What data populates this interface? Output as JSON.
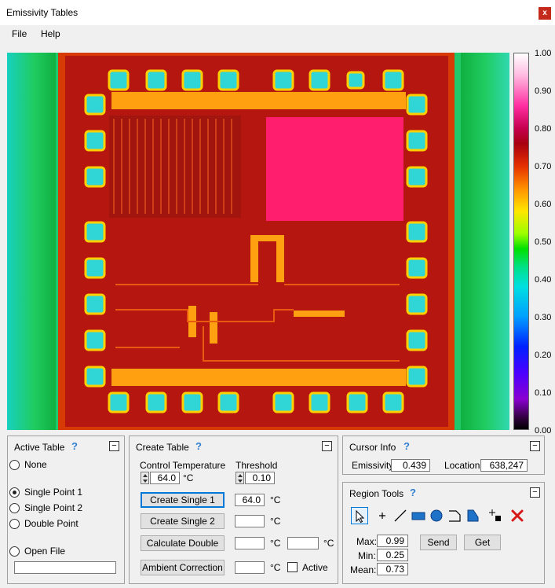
{
  "window": {
    "title": "Emissivity Tables",
    "close_glyph": "x"
  },
  "menu": {
    "items": [
      "File",
      "Help"
    ]
  },
  "colorbar": {
    "ticks": [
      "1.00",
      "0.90",
      "0.80",
      "0.70",
      "0.60",
      "0.50",
      "0.40",
      "0.30",
      "0.20",
      "0.10",
      "0.00"
    ]
  },
  "active_table": {
    "title": "Active Table",
    "help": "?",
    "collapse": "−",
    "options": [
      "None",
      "Single Point 1",
      "Single Point 2",
      "Double Point",
      "Open File"
    ],
    "selected": "Single Point 1",
    "file_path": ""
  },
  "create_table": {
    "title": "Create Table",
    "help": "?",
    "collapse": "−",
    "control_temp_label": "Control Temperature",
    "control_temp_value": "64.0",
    "threshold_label": "Threshold",
    "threshold_value": "0.10",
    "unit": "°C",
    "buttons": {
      "single1": "Create Single 1",
      "single2": "Create Single 2",
      "double": "Calculate Double",
      "ambient": "Ambient Correction"
    },
    "single1_value": "64.0",
    "single2_value": "",
    "double_value_a": "",
    "double_value_b": "",
    "ambient_value": "",
    "active_label": "Active",
    "active_checked": false
  },
  "cursor_info": {
    "title": "Cursor Info",
    "help": "?",
    "collapse": "−",
    "emissivity_label": "Emissivity",
    "emissivity_value": "0.439",
    "location_label": "Location",
    "location_value": "638,247"
  },
  "region_tools": {
    "title": "Region Tools",
    "help": "?",
    "collapse": "−",
    "tools": [
      "pointer-icon",
      "crosshair-icon",
      "line-icon",
      "rectangle-icon",
      "ellipse-icon",
      "polygon-icon",
      "freehand-icon",
      "add-point-icon",
      "delete-icon"
    ],
    "active_tool": "pointer-icon",
    "max_label": "Max:",
    "max_value": "0.99",
    "min_label": "Min:",
    "min_value": "0.25",
    "mean_label": "Mean:",
    "mean_value": "0.73",
    "send_label": "Send",
    "get_label": "Get"
  },
  "colors": {
    "die_background": "#b8160f",
    "chip_frame": "#e84a00",
    "bond_pad": "#33d8d8",
    "metal_trace": "#ff9a10",
    "edge_green": "#14c85a",
    "pink_region": "#ff1e6e",
    "accent_blue": "#0078d7"
  }
}
